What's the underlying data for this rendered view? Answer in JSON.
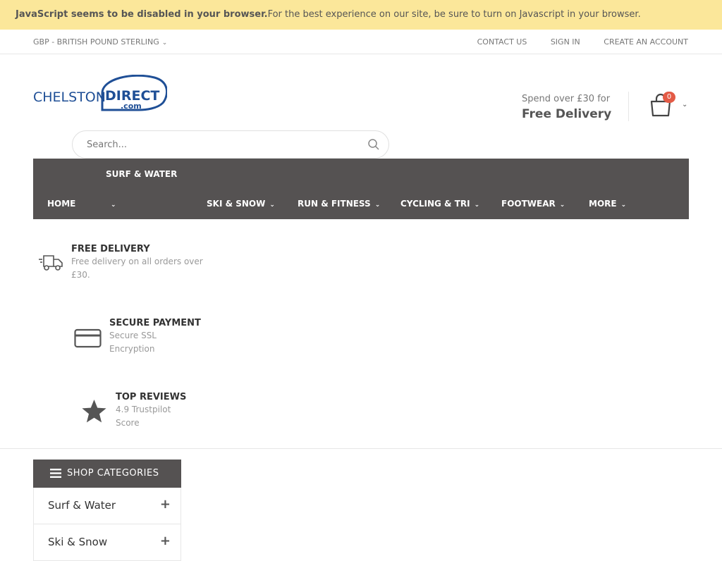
{
  "notice": {
    "bold": "JavaScript seems to be disabled in your browser.",
    "text": "For the best experience on our site, be sure to turn on Javascript in your browser."
  },
  "topbar": {
    "currency": "GBP - BRITISH POUND STERLING",
    "links": [
      "CONTACT US",
      "SIGN IN",
      "CREATE AN ACCOUNT"
    ]
  },
  "logo": {
    "line1": "CHELSTON",
    "line2": "DIRECT",
    "line3": ".com"
  },
  "promo": {
    "line1": "Spend over £30 for",
    "line2": "Free Delivery"
  },
  "cart": {
    "count": "0"
  },
  "search": {
    "placeholder": "Search..."
  },
  "nav": {
    "home": "HOME",
    "surf": "SURF & WATER",
    "ski": "SKI & SNOW",
    "run": "RUN & FITNESS",
    "cycling": "CYCLING & TRI",
    "footwear": "FOOTWEAR",
    "more": "MORE"
  },
  "features": [
    {
      "title": "FREE DELIVERY",
      "desc1": "Free delivery on all orders over",
      "desc2": "£30."
    },
    {
      "title": "SECURE PAYMENT",
      "desc1": "Secure SSL",
      "desc2": "Encryption"
    },
    {
      "title": "TOP REVIEWS",
      "desc1": "4.9 Trustpilot",
      "desc2": "Score"
    }
  ],
  "sidebar": {
    "title": "SHOP CATEGORIES",
    "categories": [
      "Surf & Water",
      "Ski & Snow"
    ]
  },
  "colors": {
    "notice_bg": "#fbe79a",
    "nav_bg": "#555252",
    "brand_blue": "#1f4f96",
    "badge": "#e35a45"
  }
}
